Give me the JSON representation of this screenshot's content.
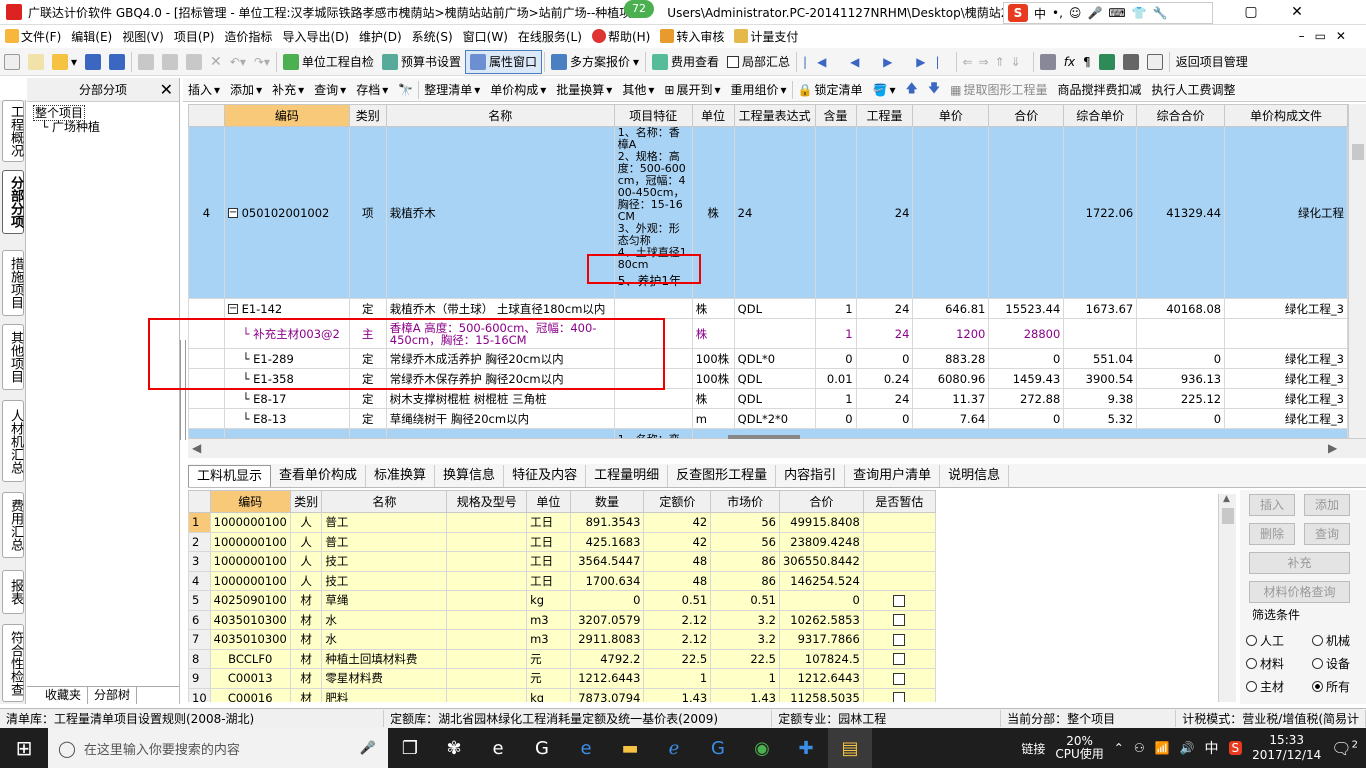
{
  "window": {
    "title": "广联达计价软件 GBQ4.0 - [招标管理 - 单位工程:汉孝城际铁路孝感市槐荫站>槐荫站站前广场>站前广场--种植项",
    "title_tail": "Users\\Administrator.PC-20141127NRHM\\Desktop\\槐荫站2",
    "badge": "72",
    "ime": {
      "logo": "S",
      "lang": "中",
      "punct": "•,"
    }
  },
  "menu": [
    "文件(F)",
    "编辑(E)",
    "视图(V)",
    "项目(P)",
    "造价指标",
    "导入导出(D)",
    "维护(D)",
    "系统(S)",
    "窗口(W)",
    "在线服务(L)",
    "帮助(H)",
    "转入审核",
    "计量支付"
  ],
  "toolbar1": {
    "unit_check": "单位工程自检",
    "budget_settings": "预算书设置",
    "property_window": "属性窗口",
    "multi_quote": "多方案报价",
    "cost_view": "费用查看",
    "partial_sum": "局部汇总",
    "return_project": "返回项目管理"
  },
  "leftnav": [
    "工程概况",
    "分部分项",
    "措施项目",
    "其他项目",
    "人材机汇总",
    "费用汇总",
    "报表",
    "符合性检查"
  ],
  "tree": {
    "title": "分部分项",
    "root": "整个项目",
    "child": "广场种植",
    "tabs": [
      "收藏夹",
      "分部树"
    ]
  },
  "toolbar2": [
    "插入",
    "添加",
    "补充",
    "查询",
    "存档",
    "整理清单",
    "单价构成",
    "批量换算",
    "其他",
    "展开到",
    "重用组价",
    "锁定清单",
    "提取图形工程量",
    "商品搅拌费扣减",
    "执行人工费调整"
  ],
  "grid": {
    "headers": [
      "",
      "编码",
      "类别",
      "名称",
      "项目特征",
      "单位",
      "工程量表达式",
      "含量",
      "工程量",
      "单价",
      "合价",
      "综合单价",
      "综合合价",
      "单价构成文件"
    ],
    "main_row": {
      "no": "4",
      "code": "050102001002",
      "type": "项",
      "name": "栽植乔木",
      "feature": "1、名称：香樟A\n2、规格：高度：500-600cm，冠幅：400-450cm，胸径：15-16CM\n3、外观：形态匀称\n4、土球直径180cm",
      "feature_last": "5、养护1年",
      "unit": "株",
      "expr": "24",
      "qty": "24",
      "total_unit": "1722.06",
      "total": "41329.44",
      "file": "绿化工程"
    },
    "sub_rows": [
      {
        "code": "E1-142",
        "type": "定",
        "name": "栽植乔木（带土球） 土球直径180cm以内",
        "unit": "株",
        "expr": "QDL",
        "content": "1",
        "qty": "24",
        "price": "646.81",
        "sum": "15523.44",
        "cu": "1673.67",
        "ct": "40168.08",
        "file": "绿化工程_3"
      },
      {
        "code": "补充主材003@2",
        "type": "主",
        "name": "香樟A 高度：500-600cm、冠幅：400-450cm，胸径：15-16CM",
        "unit": "株",
        "expr": "",
        "content": "1",
        "qty": "24",
        "price": "1200",
        "sum": "28800",
        "cu": "",
        "ct": "",
        "file": ""
      },
      {
        "code": "E1-289",
        "type": "定",
        "name": "常绿乔木成活养护 胸径20cm以内",
        "unit": "100株",
        "expr": "QDL*0",
        "content": "0",
        "qty": "0",
        "price": "883.28",
        "sum": "0",
        "cu": "551.04",
        "ct": "0",
        "file": "绿化工程_3"
      },
      {
        "code": "E1-358",
        "type": "定",
        "name": "常绿乔木保存养护 胸径20cm以内",
        "unit": "100株",
        "expr": "QDL",
        "content": "0.01",
        "qty": "0.24",
        "price": "6080.96",
        "sum": "1459.43",
        "cu": "3900.54",
        "ct": "936.13",
        "file": "绿化工程_3"
      },
      {
        "code": "E8-17",
        "type": "定",
        "name": "树木支撑树棍桩 树棍桩 三角桩",
        "unit": "株",
        "expr": "QDL",
        "content": "1",
        "qty": "24",
        "price": "11.37",
        "sum": "272.88",
        "cu": "9.38",
        "ct": "225.12",
        "file": "绿化工程_3"
      },
      {
        "code": "E8-13",
        "type": "定",
        "name": "草绳绕树干 胸径20cm以内",
        "unit": "m",
        "expr": "QDL*2*0",
        "content": "0",
        "qty": "0",
        "price": "7.64",
        "sum": "0",
        "cu": "5.32",
        "ct": "0",
        "file": "绿化工程_3"
      }
    ],
    "next_feature": "1、名称：栾"
  },
  "bottom_tabs": [
    "工料机显示",
    "查看单价构成",
    "标准换算",
    "换算信息",
    "特征及内容",
    "工程量明细",
    "反查图形工程量",
    "内容指引",
    "查询用户清单",
    "说明信息"
  ],
  "subgrid": {
    "headers": [
      "",
      "编码",
      "类别",
      "名称",
      "规格及型号",
      "单位",
      "数量",
      "定额价",
      "市场价",
      "合价",
      "是否暂估"
    ],
    "rows": [
      {
        "n": "1",
        "code": "1000000100",
        "type": "人",
        "name": "普工",
        "unit": "工日",
        "qty": "891.3543",
        "base": "42",
        "market": "56",
        "total": "49915.8408",
        "est": false
      },
      {
        "n": "2",
        "code": "1000000100",
        "type": "人",
        "name": "普工",
        "unit": "工日",
        "qty": "425.1683",
        "base": "42",
        "market": "56",
        "total": "23809.4248",
        "est": false
      },
      {
        "n": "3",
        "code": "1000000100",
        "type": "人",
        "name": "技工",
        "unit": "工日",
        "qty": "3564.5447",
        "base": "48",
        "market": "86",
        "total": "306550.8442",
        "est": false
      },
      {
        "n": "4",
        "code": "1000000100",
        "type": "人",
        "name": "技工",
        "unit": "工日",
        "qty": "1700.634",
        "base": "48",
        "market": "86",
        "total": "146254.524",
        "est": false
      },
      {
        "n": "5",
        "code": "4025090100",
        "type": "材",
        "name": "草绳",
        "unit": "kg",
        "qty": "0",
        "base": "0.51",
        "market": "0.51",
        "total": "0",
        "est": true
      },
      {
        "n": "6",
        "code": "4035010300",
        "type": "材",
        "name": "水",
        "unit": "m3",
        "qty": "3207.0579",
        "base": "2.12",
        "market": "3.2",
        "total": "10262.5853",
        "est": true
      },
      {
        "n": "7",
        "code": "4035010300",
        "type": "材",
        "name": "水",
        "unit": "m3",
        "qty": "2911.8083",
        "base": "2.12",
        "market": "3.2",
        "total": "9317.7866",
        "est": true
      },
      {
        "n": "8",
        "code": "BCCLF0",
        "type": "材",
        "name": "种植土回填材料费",
        "unit": "元",
        "qty": "4792.2",
        "base": "22.5",
        "market": "22.5",
        "total": "107824.5",
        "est": true
      },
      {
        "n": "9",
        "code": "C00013",
        "type": "材",
        "name": "零星材料费",
        "unit": "元",
        "qty": "1212.6443",
        "base": "1",
        "market": "1",
        "total": "1212.6443",
        "est": true
      },
      {
        "n": "10",
        "code": "C00016",
        "type": "材",
        "name": "肥料",
        "unit": "kg",
        "qty": "7873.0794",
        "base": "1.43",
        "market": "1.43",
        "total": "11258.5035",
        "est": true
      }
    ]
  },
  "rightpanel": {
    "insert": "插入",
    "add": "添加",
    "delete": "删除",
    "query": "查询",
    "supplement": "补充",
    "price_query": "材料价格查询",
    "filter_title": "筛选条件",
    "filters": [
      "人工",
      "机械",
      "材料",
      "设备",
      "主材",
      "所有"
    ]
  },
  "status": {
    "list_lib": "清单库：工程量清单项目设置规则(2008-湖北)",
    "quota_lib": "定额库：湖北省园林绿化工程消耗量定额及统一基价表(2009)",
    "quota_major": "定额专业：园林工程",
    "current": "当前分部：整个项目",
    "tax": "计税模式：营业税/增值税(简易计"
  },
  "taskbar": {
    "search_placeholder": "在这里输入你要搜索的内容",
    "link": "链接",
    "cpu": "20%",
    "cpu_label": "CPU使用",
    "ime": "中",
    "time": "15:33",
    "date": "2017/12/14",
    "notif": "2"
  }
}
